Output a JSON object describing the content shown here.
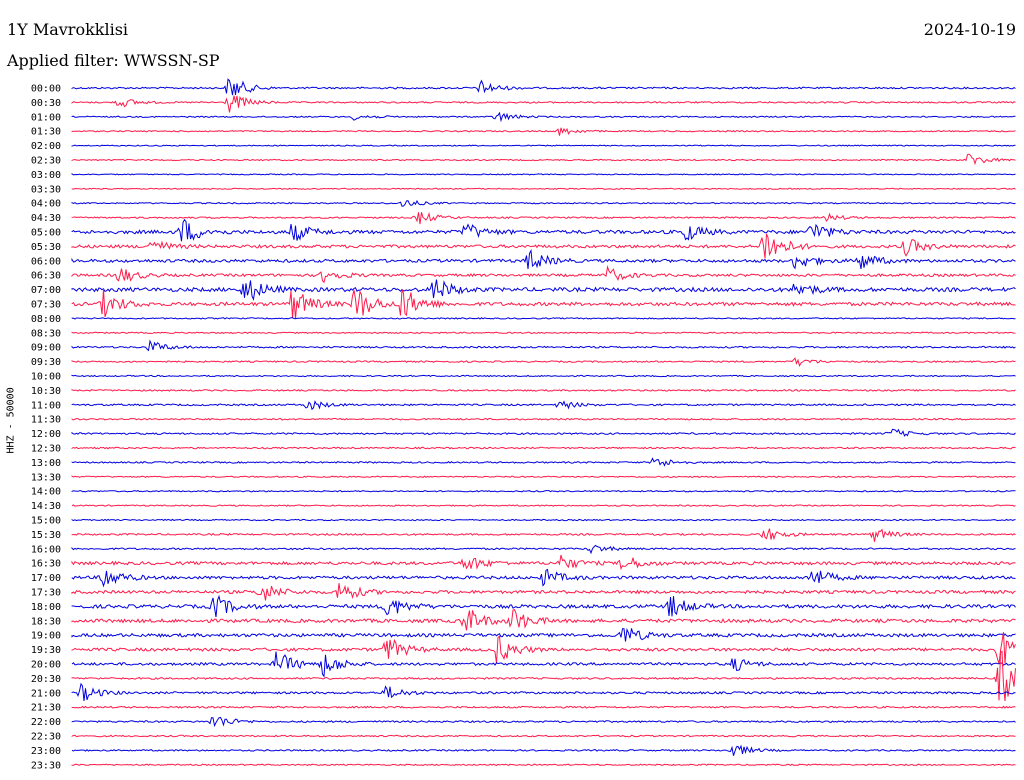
{
  "header": {
    "station": "1Y Mavrokklisi",
    "date": "2024-10-19",
    "filter_text": "Applied filter: WWSSN-SP"
  },
  "colors": {
    "even_row": "#0000e0",
    "odd_row": "#ff1a4a",
    "text": "#000000"
  },
  "chart_data": {
    "type": "line",
    "title": "1Y Mavrokklisi",
    "subtitle": "Applied filter: WWSSN-SP",
    "ylabel": "HHZ - 50000",
    "xlabel": "",
    "row_labels": [
      "00:00",
      "00:30",
      "01:00",
      "01:30",
      "02:00",
      "02:30",
      "03:00",
      "03:30",
      "04:00",
      "04:30",
      "05:00",
      "05:30",
      "06:00",
      "06:30",
      "07:00",
      "07:30",
      "08:00",
      "08:30",
      "09:00",
      "09:30",
      "10:00",
      "10:30",
      "11:00",
      "11:30",
      "12:00",
      "12:30",
      "13:00",
      "13:30",
      "14:00",
      "14:30",
      "15:00",
      "15:30",
      "16:00",
      "16:30",
      "17:00",
      "17:30",
      "18:00",
      "18:30",
      "19:00",
      "19:30",
      "20:00",
      "20:30",
      "21:00",
      "21:30",
      "22:00",
      "22:30",
      "23:00",
      "23:30"
    ],
    "row_activity": [
      0.2,
      0.15,
      0.1,
      0.1,
      0.05,
      0.1,
      0.05,
      0.05,
      0.1,
      0.15,
      0.6,
      0.5,
      0.5,
      0.4,
      0.7,
      0.6,
      0.1,
      0.1,
      0.2,
      0.15,
      0.1,
      0.15,
      0.2,
      0.15,
      0.2,
      0.15,
      0.15,
      0.1,
      0.1,
      0.1,
      0.1,
      0.2,
      0.2,
      0.5,
      0.5,
      0.5,
      0.6,
      0.6,
      0.55,
      0.5,
      0.4,
      0.2,
      0.3,
      0.2,
      0.2,
      0.15,
      0.15,
      0.1
    ],
    "events": [
      {
        "row": 0,
        "minute": 5.0,
        "amp": 1.5
      },
      {
        "row": 0,
        "minute": 13.0,
        "amp": 0.8
      },
      {
        "row": 1,
        "minute": 5.0,
        "amp": 1.2
      },
      {
        "row": 1,
        "minute": 1.5,
        "amp": 0.6
      },
      {
        "row": 2,
        "minute": 13.5,
        "amp": 0.6
      },
      {
        "row": 2,
        "minute": 9.0,
        "amp": 0.4
      },
      {
        "row": 3,
        "minute": 15.5,
        "amp": 0.5
      },
      {
        "row": 5,
        "minute": 28.5,
        "amp": 0.8
      },
      {
        "row": 8,
        "minute": 10.5,
        "amp": 0.5
      },
      {
        "row": 9,
        "minute": 11.0,
        "amp": 0.8
      },
      {
        "row": 9,
        "minute": 24.0,
        "amp": 0.4
      },
      {
        "row": 10,
        "minute": 3.5,
        "amp": 1.6
      },
      {
        "row": 10,
        "minute": 7.0,
        "amp": 1.1
      },
      {
        "row": 10,
        "minute": 12.5,
        "amp": 1.0
      },
      {
        "row": 10,
        "minute": 19.5,
        "amp": 1.0
      },
      {
        "row": 10,
        "minute": 23.5,
        "amp": 1.2
      },
      {
        "row": 11,
        "minute": 22.0,
        "amp": 2.5
      },
      {
        "row": 11,
        "minute": 26.5,
        "amp": 1.0
      },
      {
        "row": 11,
        "minute": 2.5,
        "amp": 0.8
      },
      {
        "row": 12,
        "minute": 14.5,
        "amp": 1.3
      },
      {
        "row": 12,
        "minute": 23.0,
        "amp": 1.0
      },
      {
        "row": 12,
        "minute": 25.0,
        "amp": 1.1
      },
      {
        "row": 13,
        "minute": 1.5,
        "amp": 1.0
      },
      {
        "row": 13,
        "minute": 8.0,
        "amp": 0.8
      },
      {
        "row": 13,
        "minute": 17.0,
        "amp": 0.9
      },
      {
        "row": 14,
        "minute": 5.5,
        "amp": 1.6
      },
      {
        "row": 14,
        "minute": 11.5,
        "amp": 1.4
      },
      {
        "row": 14,
        "minute": 23.0,
        "amp": 0.9
      },
      {
        "row": 15,
        "minute": 1.0,
        "amp": 1.5
      },
      {
        "row": 15,
        "minute": 7.0,
        "amp": 2.0
      },
      {
        "row": 15,
        "minute": 9.0,
        "amp": 2.2
      },
      {
        "row": 15,
        "minute": 10.5,
        "amp": 2.0
      },
      {
        "row": 18,
        "minute": 2.5,
        "amp": 0.7
      },
      {
        "row": 19,
        "minute": 23.0,
        "amp": 0.5
      },
      {
        "row": 22,
        "minute": 7.5,
        "amp": 0.6
      },
      {
        "row": 22,
        "minute": 15.5,
        "amp": 0.5
      },
      {
        "row": 24,
        "minute": 26.0,
        "amp": 0.6
      },
      {
        "row": 26,
        "minute": 18.5,
        "amp": 0.7
      },
      {
        "row": 31,
        "minute": 22.0,
        "amp": 0.9
      },
      {
        "row": 31,
        "minute": 25.5,
        "amp": 0.8
      },
      {
        "row": 32,
        "minute": 16.5,
        "amp": 0.5
      },
      {
        "row": 33,
        "minute": 12.5,
        "amp": 1.0
      },
      {
        "row": 33,
        "minute": 15.5,
        "amp": 0.9
      },
      {
        "row": 33,
        "minute": 17.5,
        "amp": 1.0
      },
      {
        "row": 34,
        "minute": 1.0,
        "amp": 1.3
      },
      {
        "row": 34,
        "minute": 15.0,
        "amp": 1.0
      },
      {
        "row": 34,
        "minute": 23.5,
        "amp": 1.2
      },
      {
        "row": 35,
        "minute": 6.0,
        "amp": 1.2
      },
      {
        "row": 35,
        "minute": 8.5,
        "amp": 1.3
      },
      {
        "row": 36,
        "minute": 4.5,
        "amp": 1.4
      },
      {
        "row": 36,
        "minute": 10.0,
        "amp": 1.3
      },
      {
        "row": 36,
        "minute": 19.0,
        "amp": 1.3
      },
      {
        "row": 37,
        "minute": 12.5,
        "amp": 1.6
      },
      {
        "row": 37,
        "minute": 14.0,
        "amp": 1.4
      },
      {
        "row": 38,
        "minute": 17.5,
        "amp": 1.2
      },
      {
        "row": 39,
        "minute": 10.0,
        "amp": 1.5
      },
      {
        "row": 39,
        "minute": 13.5,
        "amp": 1.7
      },
      {
        "row": 39,
        "minute": 29.5,
        "amp": 2.5
      },
      {
        "row": 40,
        "minute": 6.5,
        "amp": 1.6
      },
      {
        "row": 40,
        "minute": 8.0,
        "amp": 1.4
      },
      {
        "row": 40,
        "minute": 21.0,
        "amp": 0.8
      },
      {
        "row": 41,
        "minute": 29.5,
        "amp": 3.5
      },
      {
        "row": 42,
        "minute": 0.3,
        "amp": 1.0
      },
      {
        "row": 42,
        "minute": 10.0,
        "amp": 0.8
      },
      {
        "row": 44,
        "minute": 4.5,
        "amp": 0.9
      },
      {
        "row": 46,
        "minute": 21.0,
        "amp": 0.8
      }
    ]
  }
}
